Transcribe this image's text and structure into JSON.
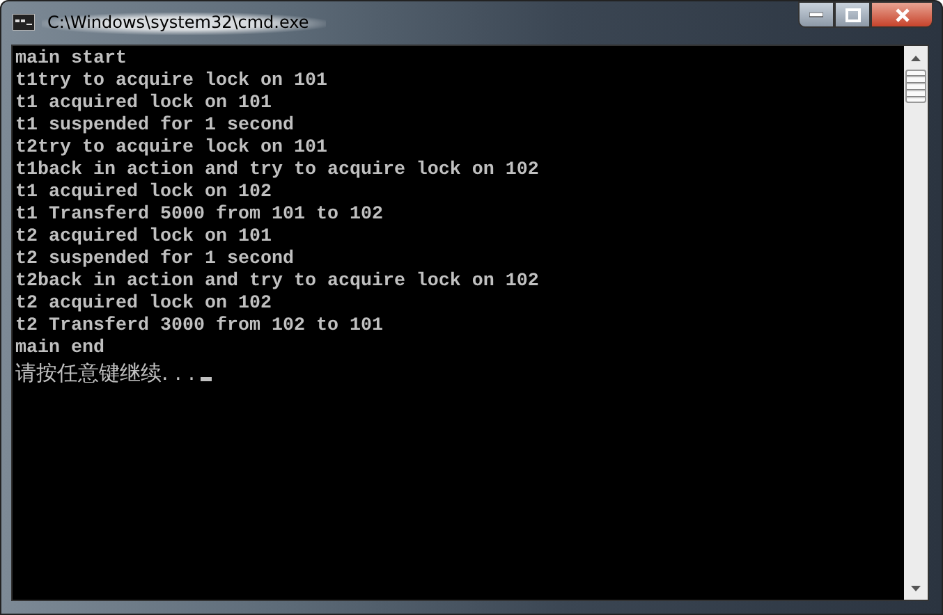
{
  "window": {
    "title": "C:\\Windows\\system32\\cmd.exe"
  },
  "console": {
    "lines": [
      "main start",
      "t1try to acquire lock on 101",
      "t1 acquired lock on 101",
      "t1 suspended for 1 second",
      "t2try to acquire lock on 101",
      "t1back in action and try to acquire lock on 102",
      "t1 acquired lock on 102",
      "t1 Transferd 5000 from 101 to 102",
      "t2 acquired lock on 101",
      "t2 suspended for 1 second",
      "t2back in action and try to acquire lock on 102",
      "t2 acquired lock on 102",
      "t2 Transferd 3000 from 102 to 101",
      "main end"
    ],
    "prompt": "请按任意键继续. . ."
  }
}
